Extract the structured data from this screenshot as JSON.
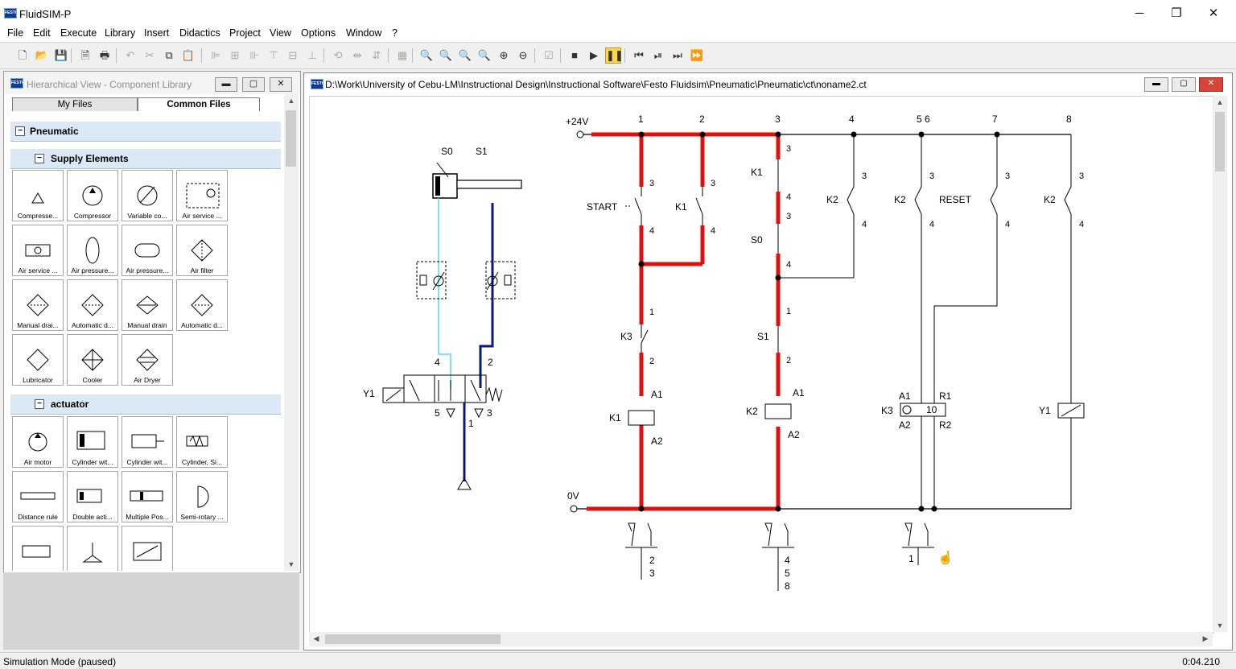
{
  "app": {
    "title": "FluidSIM-P",
    "logo_text": "FESTO"
  },
  "menu": [
    "File",
    "Edit",
    "Execute",
    "Library",
    "Insert",
    "Didactics",
    "Project",
    "View",
    "Options",
    "Window",
    "?"
  ],
  "toolbar": {
    "icons": [
      {
        "name": "new-icon",
        "glyph": "🗋",
        "state": "enabled"
      },
      {
        "name": "open-icon",
        "glyph": "📂",
        "state": "enabled"
      },
      {
        "name": "save-icon",
        "glyph": "💾",
        "state": "enabled"
      },
      {
        "name": "print-preview-icon",
        "glyph": "🗎",
        "state": "enabled"
      },
      {
        "name": "print-icon",
        "glyph": "🖶",
        "state": "enabled"
      },
      {
        "name": "undo-icon",
        "glyph": "↶",
        "state": "disabled"
      },
      {
        "name": "cut-icon",
        "glyph": "✂",
        "state": "disabled"
      },
      {
        "name": "copy-icon",
        "glyph": "⧉",
        "state": "enabled"
      },
      {
        "name": "paste-icon",
        "glyph": "📋",
        "state": "enabled"
      },
      {
        "name": "align-left-icon",
        "glyph": "⊫",
        "state": "disabled"
      },
      {
        "name": "align-center-icon",
        "glyph": "⊞",
        "state": "disabled"
      },
      {
        "name": "align-right-icon",
        "glyph": "⊪",
        "state": "disabled"
      },
      {
        "name": "align-top-icon",
        "glyph": "⊤",
        "state": "disabled"
      },
      {
        "name": "align-middle-icon",
        "glyph": "⊟",
        "state": "disabled"
      },
      {
        "name": "align-bottom-icon",
        "glyph": "⊥",
        "state": "disabled"
      },
      {
        "name": "rotate-icon",
        "glyph": "⟲",
        "state": "disabled"
      },
      {
        "name": "flip-horizontal-icon",
        "glyph": "⇹",
        "state": "disabled"
      },
      {
        "name": "flip-vertical-icon",
        "glyph": "⇵",
        "state": "disabled"
      },
      {
        "name": "grid-icon",
        "glyph": "▦",
        "state": "disabled"
      },
      {
        "name": "zoom-original-icon",
        "glyph": "🔍",
        "state": "enabled"
      },
      {
        "name": "zoom-circuit-icon",
        "glyph": "🔍",
        "state": "enabled"
      },
      {
        "name": "zoom-window-icon",
        "glyph": "🔍",
        "state": "enabled"
      },
      {
        "name": "zoom-last-icon",
        "glyph": "🔍",
        "state": "enabled"
      },
      {
        "name": "zoom-in-icon",
        "glyph": "⊕",
        "state": "enabled"
      },
      {
        "name": "zoom-out-icon",
        "glyph": "⊖",
        "state": "enabled"
      },
      {
        "name": "check-drawing-icon",
        "glyph": "☑",
        "state": "disabled"
      },
      {
        "name": "stop-icon",
        "glyph": "■",
        "state": "enabled"
      },
      {
        "name": "play-icon",
        "glyph": "▶",
        "state": "enabled"
      },
      {
        "name": "pause-icon",
        "glyph": "❚❚",
        "state": "active"
      },
      {
        "name": "reset-icon",
        "glyph": "⏮",
        "state": "enabled"
      },
      {
        "name": "single-step-icon",
        "glyph": "⏯",
        "state": "enabled"
      },
      {
        "name": "step-to-end-icon",
        "glyph": "⏭",
        "state": "enabled"
      },
      {
        "name": "fast-forward-icon",
        "glyph": "⏩",
        "state": "disabled"
      }
    ]
  },
  "library": {
    "title": "Hierarchical View - Component Library",
    "tabs": [
      {
        "label": "My Files",
        "selected": false
      },
      {
        "label": "Common Files",
        "selected": true
      }
    ],
    "groups": [
      {
        "label": "Pneumatic",
        "level": 0,
        "collapse": "−"
      },
      {
        "label": "Supply Elements",
        "level": 1,
        "collapse": "−"
      },
      {
        "label": "actuator",
        "level": 1,
        "collapse": "−"
      }
    ],
    "supply_items": [
      "Compresse...",
      "Compressor",
      "Variable co...",
      "Air service ...",
      "Air service ...",
      "Air pressure...",
      "Air pressure...",
      "Air filter",
      "Manual drai...",
      "Automatic d...",
      "Manual drain",
      "Automatic d...",
      "Lubricator",
      "Cooler",
      "Air Dryer"
    ],
    "actuator_items": [
      "Air motor",
      "Cylinder wit...",
      "Cylinder wit...",
      "Cylinder, Si...",
      "Distance rule",
      "Double acti...",
      "Multiple Pos...",
      "Semi-rotary ...",
      "",
      "",
      ""
    ]
  },
  "circuit": {
    "title": "D:\\Work\\University of Cebu-LM\\Instructional Design\\Instructional Software\\Festo Fluidsim\\Pneumatic\\Pneumatic\\ct\\noname2.ct",
    "labels": {
      "v24": "+24V",
      "v0": "0V",
      "col1": "1",
      "col2": "2",
      "col3": "3",
      "col4": "4",
      "col56": "5  6",
      "col7": "7",
      "col8": "8",
      "s0_cyl": "S0",
      "s1_cyl": "S1",
      "y1_valve": "Y1",
      "port4": "4",
      "port2": "2",
      "port5": "5",
      "port3": "3",
      "port1": "1",
      "start": "START",
      "k1": "K1",
      "k2": "K2",
      "k3": "K3",
      "s0": "S0",
      "s1": "S1",
      "reset": "RESET",
      "y1": "Y1",
      "a1": "A1",
      "a2": "A2",
      "r1": "R1",
      "r2": "R2",
      "timer_value": "10",
      "n1": "1",
      "n2": "2",
      "n3": "3",
      "n4": "4",
      "n5": "5",
      "n8": "8"
    },
    "colors": {
      "energized": "#e01010",
      "wire": "#000000",
      "pneu_light": "#5ad8e8",
      "pneu_dark": "#0a1a7a"
    }
  },
  "status": {
    "mode": "Simulation Mode (paused)",
    "time": "0:04.210"
  }
}
